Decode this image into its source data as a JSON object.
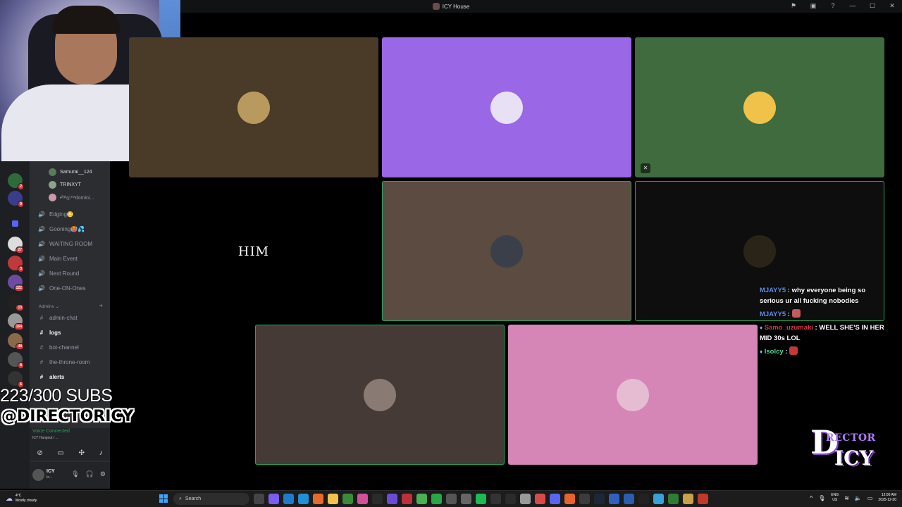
{
  "window": {
    "title": "ICY House"
  },
  "members": [
    {
      "name": "Samurai__124"
    },
    {
      "name": "TRINXYT"
    },
    {
      "name": "•ᴿᴬ◎™domini..."
    }
  ],
  "channels": [
    {
      "label": "Edging😳",
      "icon": "voice",
      "bold": false
    },
    {
      "label": "Gooning🥵💦",
      "icon": "voice",
      "bold": false
    },
    {
      "label": "WAITING ROOM",
      "icon": "voice",
      "bold": false
    },
    {
      "label": "Main Event",
      "icon": "voice",
      "bold": false
    },
    {
      "label": "Next Round",
      "icon": "voice",
      "bold": false
    },
    {
      "label": "One-ON-Ones",
      "icon": "voice",
      "bold": false
    }
  ],
  "admin_category": {
    "label": "Admins"
  },
  "admin_channels": [
    {
      "label": "admin-chat",
      "bold": false
    },
    {
      "label": "logs",
      "bold": true
    },
    {
      "label": "bot-channel",
      "bold": false
    },
    {
      "label": "the-throne-room",
      "bold": false
    },
    {
      "label": "alerts",
      "bold": true
    }
  ],
  "server_badges": [
    "2",
    "9",
    "27",
    "3",
    "122",
    "13",
    "164",
    "48",
    "8",
    "6"
  ],
  "voice": {
    "status": "Voice Connected",
    "channel": "ICY Hangout / ..."
  },
  "user": {
    "name": "ICY",
    "status": "In..."
  },
  "tiles": [
    {
      "label": "",
      "color": "#4a3a28",
      "avatar": "#b89a5e",
      "speaking": false,
      "muted": false
    },
    {
      "label": "",
      "color": "#9a67e6",
      "avatar": "#e8e0f5",
      "speaking": false,
      "muted": false
    },
    {
      "label": "",
      "color": "#3f6b3e",
      "avatar": "#f0c24a",
      "speaking": false,
      "muted": true
    },
    {
      "label": "HIM",
      "color": "#000000",
      "avatar": "",
      "speaking": false,
      "muted": false
    },
    {
      "label": "",
      "color": "#5b4b40",
      "avatar": "#3b3f4a",
      "speaking": true,
      "muted": false
    },
    {
      "label": "",
      "color": "#0e0e0e",
      "avatar": "#2a2418",
      "speaking": true,
      "muted": false
    },
    {
      "label": "",
      "color": "#463a36",
      "avatar": "#8a7a74",
      "speaking": true,
      "muted": false
    },
    {
      "label": "",
      "color": "#d586b6",
      "avatar": "#e6bcd2",
      "speaking": false,
      "muted": false
    }
  ],
  "overlay": {
    "subs": "223/300 SUBS",
    "handle": "@DIRECTORICY",
    "logo_big": "D",
    "logo_small": "RECTOR",
    "logo_icy": "ICY"
  },
  "chat": [
    {
      "user": "MJAYY5",
      "text": "why everyone being so serious ur all fucking nobodies",
      "color": "blue",
      "emote": ""
    },
    {
      "user": "MJAYY5",
      "text": "",
      "color": "blue",
      "emote": "#c25b5b"
    },
    {
      "user": "Samo_uzumaki",
      "text": "WELL SHE'S IN HER MID 30s LOL",
      "color": "red",
      "emote": ""
    },
    {
      "user": "Isolcy",
      "text": "",
      "color": "green",
      "emote": "#c2383b"
    }
  ],
  "taskbar": {
    "weather_temp": "4°C",
    "weather_desc": "Mostly cloudy",
    "search_placeholder": "Search",
    "lang_top": "ENG",
    "lang_bottom": "US",
    "time": "12:00 AM",
    "date": "2025-12-30"
  }
}
